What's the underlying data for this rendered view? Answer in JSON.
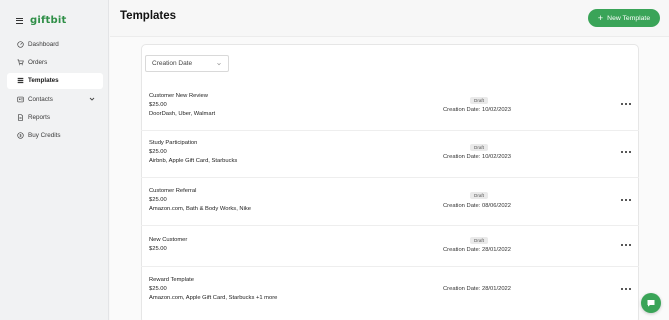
{
  "brand": {
    "name": "giftbit",
    "color": "#2f8f47"
  },
  "sidebar": {
    "items": [
      {
        "label": "Dashboard",
        "icon": "dashboard-icon",
        "active": false
      },
      {
        "label": "Orders",
        "icon": "cart-icon",
        "active": false
      },
      {
        "label": "Templates",
        "icon": "templates-icon",
        "active": true
      },
      {
        "label": "Contacts",
        "icon": "contacts-icon",
        "active": false,
        "expandable": true
      },
      {
        "label": "Reports",
        "icon": "reports-icon",
        "active": false
      },
      {
        "label": "Buy Credits",
        "icon": "credits-icon",
        "active": false
      }
    ]
  },
  "header": {
    "title": "Templates",
    "new_button_label": "New Template",
    "accent": "#3aa458"
  },
  "filter": {
    "selected": "Creation Date"
  },
  "templates": [
    {
      "title": "Customer New Review",
      "amount": "$25.00",
      "brands": "DoorDash, Uber, Walmart",
      "status": "Draft",
      "date": "Creation Date: 10/02/2023"
    },
    {
      "title": "Study Participation",
      "amount": "$25.00",
      "brands": "Airbnb, Apple Gift Card, Starbucks",
      "status": "Draft",
      "date": "Creation Date: 10/02/2023"
    },
    {
      "title": "Customer Referral",
      "amount": "$25.00",
      "brands": "Amazon.com, Bath & Body Works, Nike",
      "status": "Draft",
      "date": "Creation Date: 08/06/2022"
    },
    {
      "title": "New Customer",
      "amount": "$25.00",
      "brands": "",
      "status": "Draft",
      "date": "Creation Date: 28/01/2022"
    },
    {
      "title": "Reward Template",
      "amount": "$25.00",
      "brands": "Amazon.com, Apple Gift Card, Starbucks +1 more",
      "status": "",
      "date": "Creation Date: 28/01/2022"
    }
  ]
}
